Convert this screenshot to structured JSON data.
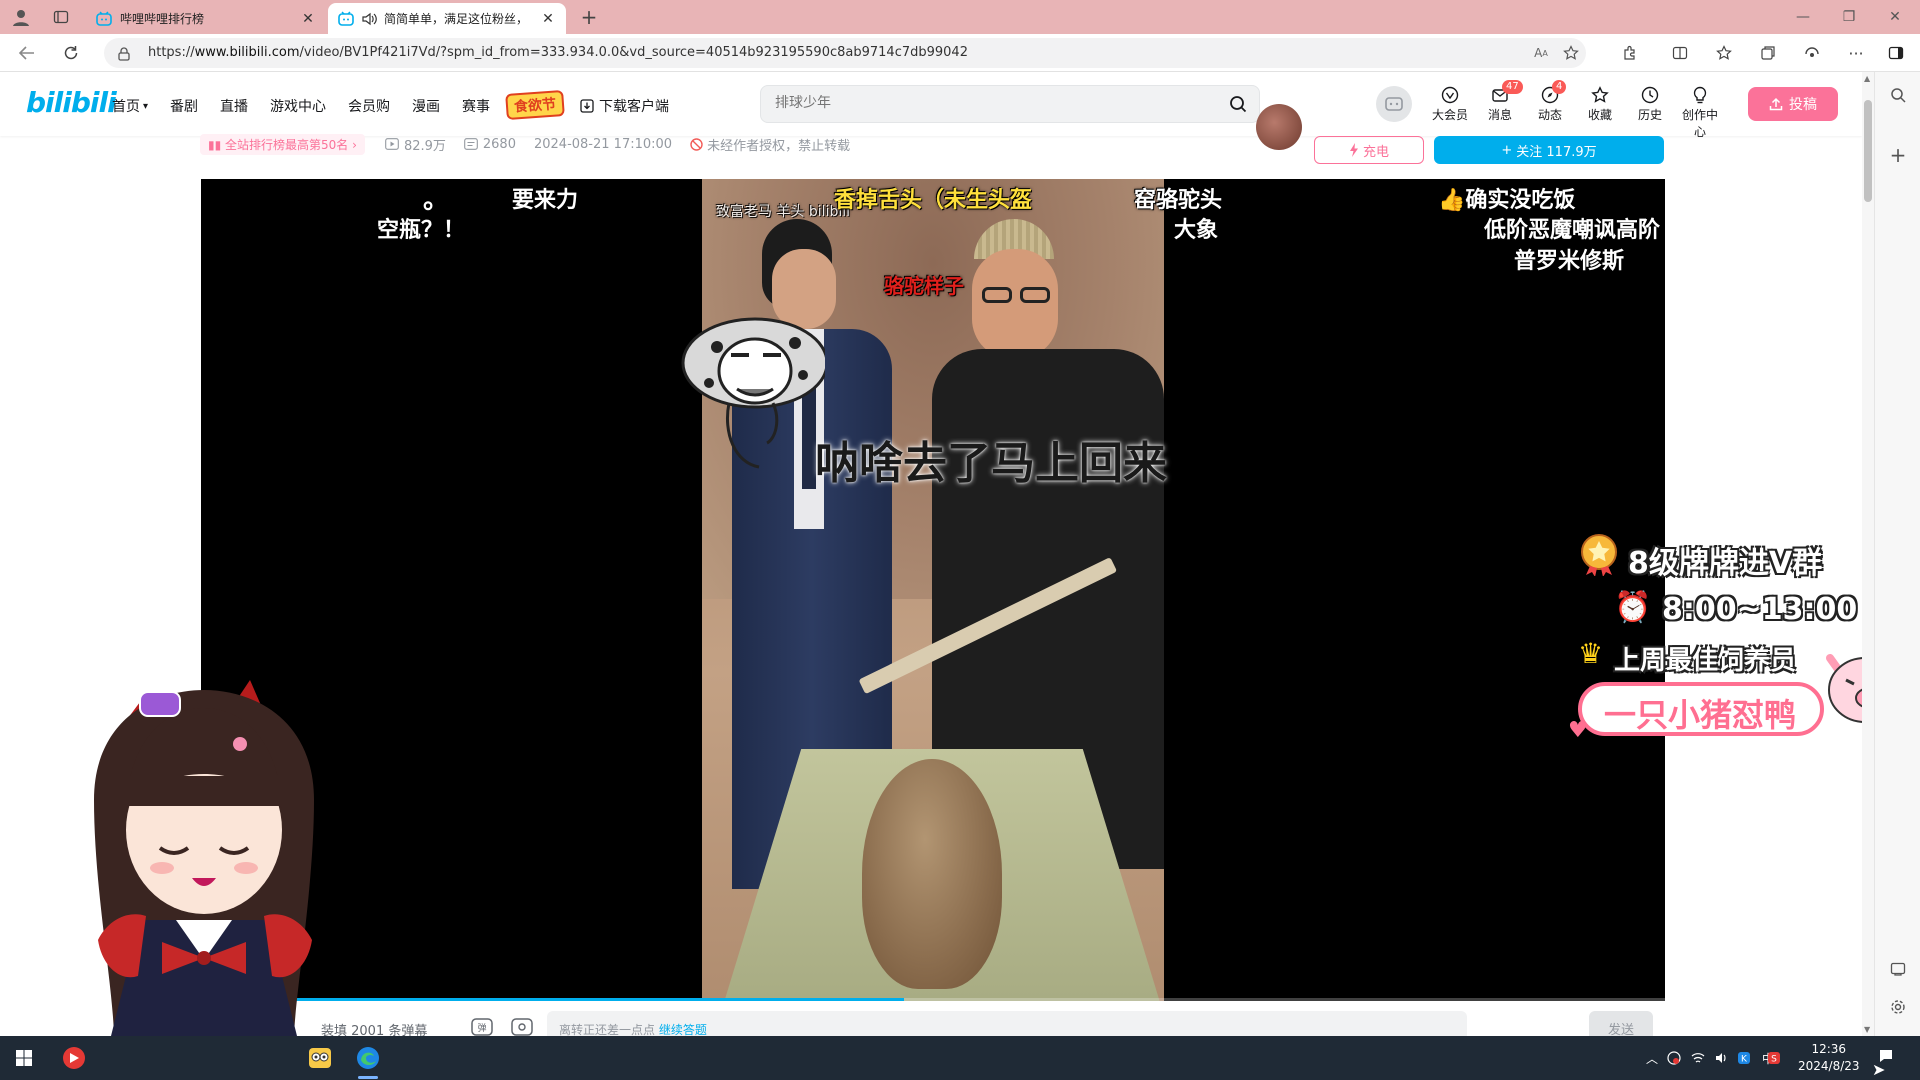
{
  "browser": {
    "tabs": [
      {
        "title": "哔哩哔哩排行榜",
        "active": false
      },
      {
        "title": "简简单单，满足这位粉丝，",
        "active": true
      }
    ],
    "url_prefix": "https://",
    "url_host": "www.bilibili.com",
    "url_path": "/video/BV1Pf421i7Vd/?spm_id_from=333.934.0.0&vd_source=40514b923195590c8ab9714c7db99042"
  },
  "header": {
    "logo": "bilibili",
    "nav": [
      "首页",
      "番剧",
      "直播",
      "游戏中心",
      "会员购",
      "漫画",
      "赛事"
    ],
    "promo": "食欲节",
    "download": "下载客户端",
    "search_placeholder": "排球少年",
    "icons": [
      {
        "label": "大会员",
        "badge": ""
      },
      {
        "label": "消息",
        "badge": "47"
      },
      {
        "label": "动态",
        "badge": "4"
      },
      {
        "label": "收藏",
        "badge": ""
      },
      {
        "label": "历史",
        "badge": ""
      },
      {
        "label": "创作中心",
        "badge": ""
      }
    ],
    "upload": "投稿"
  },
  "video_info": {
    "rank": "全站排行榜最高第50名",
    "views": "82.9万",
    "danmaku": "2680",
    "date": "2024-08-21 17:10:00",
    "notice": "未经作者授权，禁止转载",
    "charge": "充电",
    "follow": "关注 117.9万"
  },
  "player": {
    "danmaku": [
      "要来力",
      "。",
      "空瓶？！",
      "香掉舌头（未生头盔",
      "窑骆驼头",
      "大象",
      "确实没吃饭",
      "低阶恶魔嘲讽高阶",
      "普罗米修斯",
      "骆驼样子"
    ],
    "watermark": "致富老马 羊头 bilibili",
    "subtitle": "呐啥去了马上回来",
    "progress": 0.48
  },
  "overlay": {
    "line1": "8级牌牌进V群",
    "line2": "8:00~13:00",
    "line3": "上周最佳饲养员",
    "name": "一只小猪怼鸭"
  },
  "danmaku_bar": {
    "count": "装填 2001 条弹幕",
    "input_hint": "离转正还差一点点",
    "input_link": "继续答题",
    "send": "发送"
  },
  "taskbar": {
    "time": "12:36",
    "date": "2024/8/23",
    "ime": "中"
  }
}
